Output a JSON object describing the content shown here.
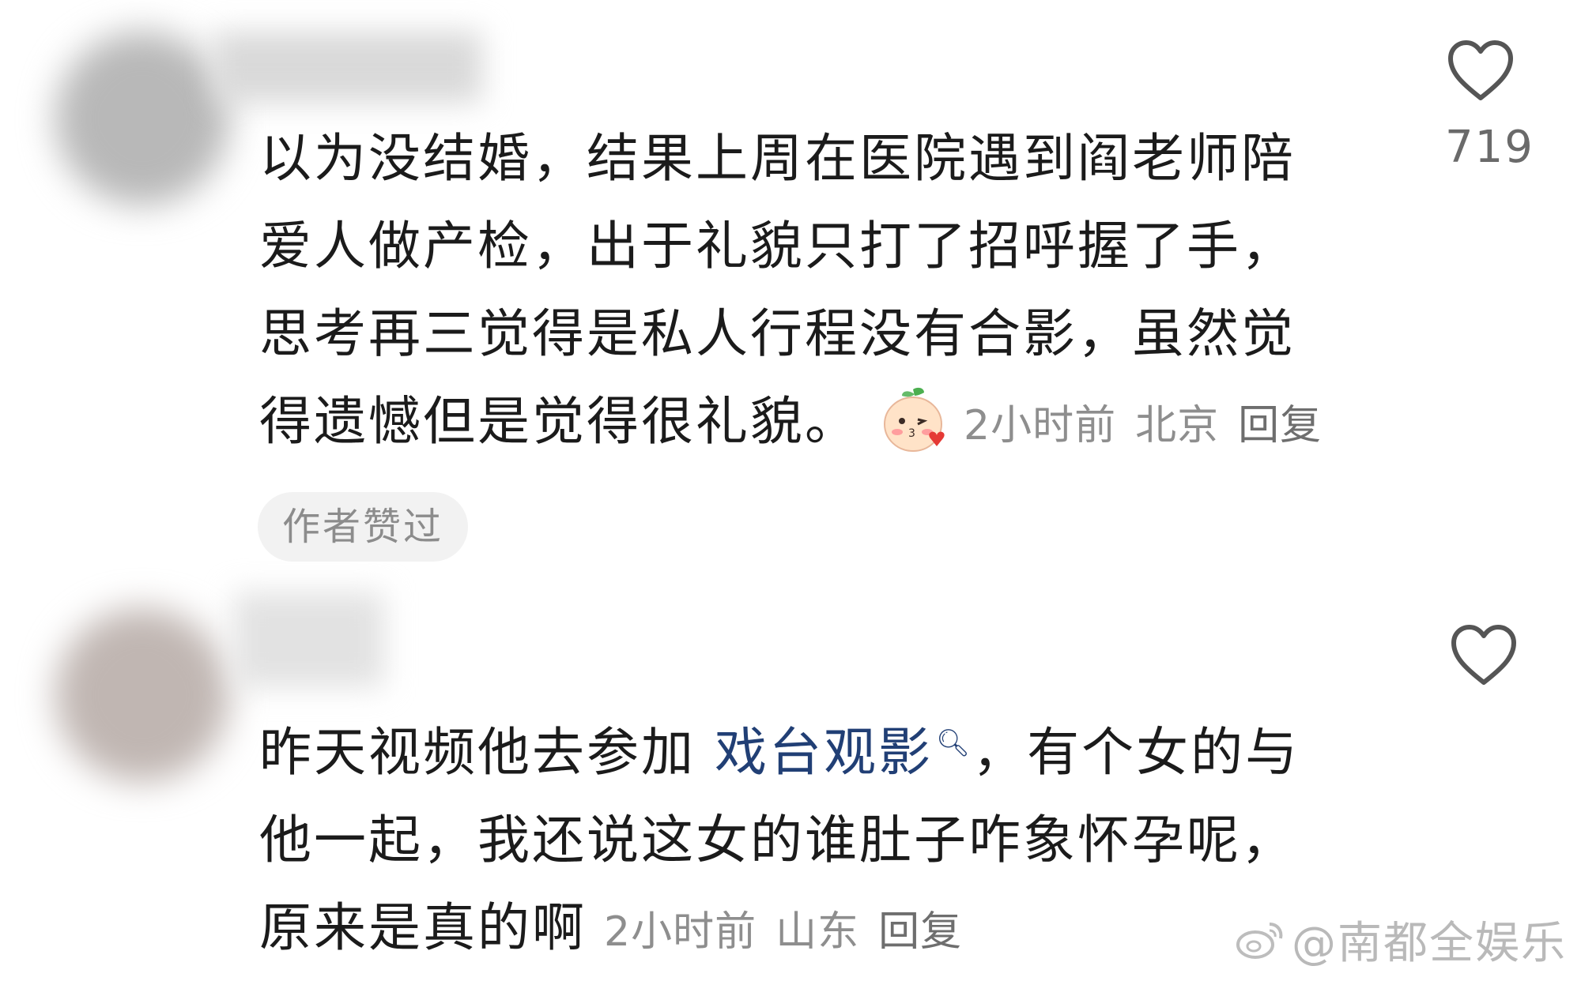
{
  "comments": [
    {
      "lines": [
        "以为没结婚，结果上周在医院遇到阎老师陪",
        "爱人做产检，出于礼貌只打了招呼握了手，",
        "思考再三觉得是私人行程没有合影，虽然觉",
        "得遗憾但是觉得很礼貌。"
      ],
      "emoji_icon": "kiss-face-emoji-icon",
      "time": "2小时前",
      "location": "北京",
      "reply_label": "回复",
      "like_count": "719",
      "badge": "作者赞过"
    },
    {
      "line1_before": "昨天视频他去参加 ",
      "line1_link": "戏台观影",
      "line1_after": "，有个女的与",
      "lines": [
        "他一起，我还说这女的谁肚子咋象怀孕呢，",
        "原来是真的啊"
      ],
      "time": "2小时前",
      "location": "山东",
      "reply_label": "回复"
    }
  ],
  "watermark": "@南都全娱乐",
  "colors": {
    "text": "#1b1b1b",
    "meta": "#8e8e8e",
    "link": "#213f75",
    "badge_bg": "#f2f2f2"
  }
}
